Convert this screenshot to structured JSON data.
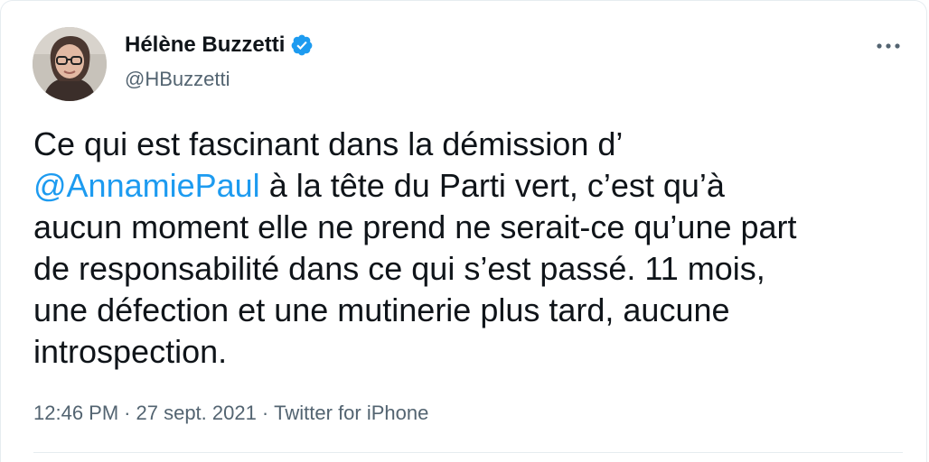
{
  "user": {
    "name": "Hélène Buzzetti",
    "handle": "@HBuzzetti",
    "verified": true,
    "avatar_icon": "profile-photo"
  },
  "tweet": {
    "text_line1_a": "Ce qui est fascinant dans la démission d’",
    "mention": "@AnnamiePaul",
    "text_rest": " à la tête du Parti vert, c’est qu’à\naucun moment elle ne prend ne serait-ce qu’une part\nde responsabilité dans ce qui s’est passé. 11 mois,\nune défection et une mutinerie plus tard, aucune\nintrospection."
  },
  "meta": {
    "time": "12:46 PM",
    "separator": "·",
    "date": "27 sept. 2021",
    "source": "Twitter for iPhone"
  },
  "icons": {
    "more": "more-horizontal-icon",
    "verified": "verified-badge-icon"
  },
  "colors": {
    "accent": "#1d9bf0",
    "text": "#0f1419",
    "secondary": "#536471"
  }
}
